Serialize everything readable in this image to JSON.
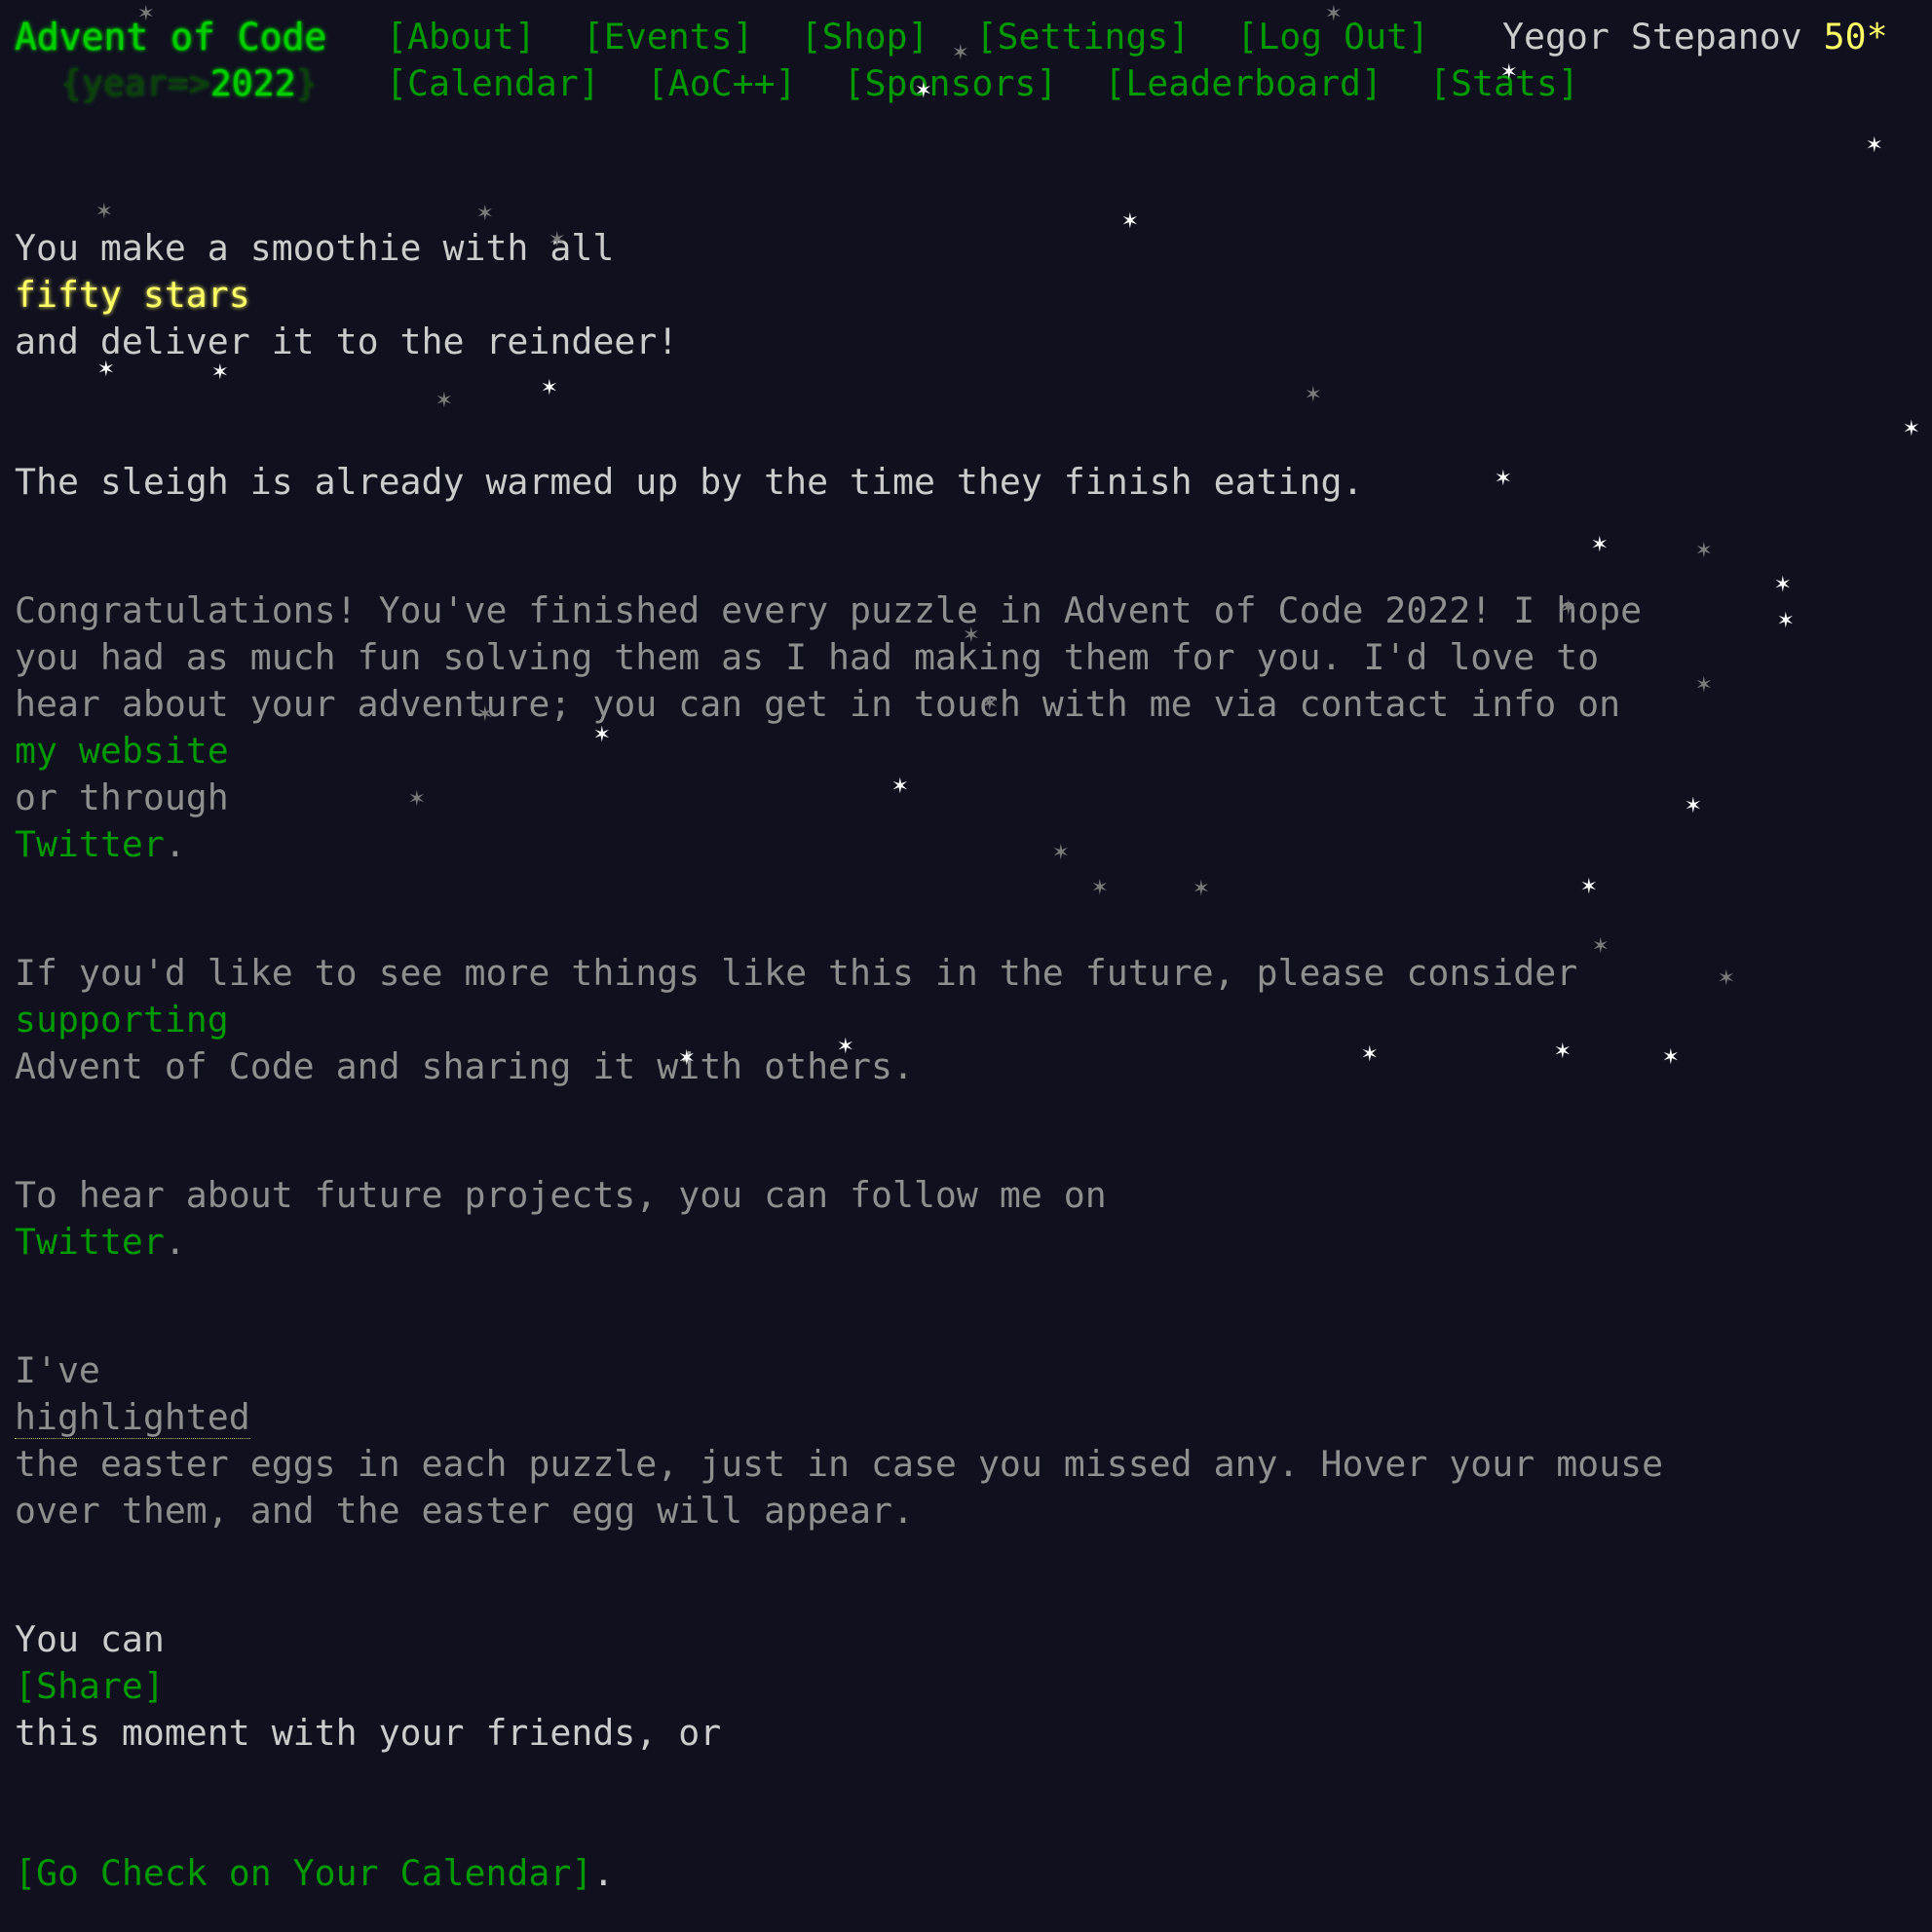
{
  "header": {
    "title": "Advent of Code",
    "year_prefix": "{year=>",
    "year": "2022",
    "year_suffix": "}",
    "nav_primary": [
      {
        "label": "[About]"
      },
      {
        "label": "[Events]"
      },
      {
        "label": "[Shop]"
      },
      {
        "label": "[Settings]"
      },
      {
        "label": "[Log Out]"
      }
    ],
    "nav_secondary": [
      {
        "label": "[Calendar]"
      },
      {
        "label": "[AoC++]"
      },
      {
        "label": "[Sponsors]"
      },
      {
        "label": "[Leaderboard]"
      },
      {
        "label": "[Stats]"
      }
    ],
    "user_name": "Yegor Stepanov",
    "star_count": "50*"
  },
  "content": {
    "intro_1": "You make a smoothie with all",
    "intro_highlight": "fifty stars",
    "intro_2": "and deliver it to the reindeer!",
    "intro_3": "The sleigh is already warmed up by the time they finish eating.",
    "congrats_1": "Congratulations! You've finished every puzzle in Advent of Code 2022! I hope you had as much fun solving them as I had making them for you. I'd love to hear about your adventure; you can get in touch with me via contact info on",
    "my_website": "my website",
    "or_through": "or through",
    "twitter_1": "Twitter",
    "period_1": ".",
    "future_1": "If you'd like to see more things like this in the future, please consider",
    "supporting": "supporting",
    "future_2": "Advent of Code and sharing it with others.",
    "hear_1": "To hear about future projects, you can follow me on",
    "twitter_2": "Twitter",
    "period_2": ".",
    "eggs_1": "I've",
    "highlighted": "highlighted",
    "eggs_2": "the easter eggs in each puzzle, just in case you missed any. Hover your mouse over them, and the easter egg will appear.",
    "share_1": "You can",
    "share_link": "[Share]",
    "share_2": "this moment with your friends, or",
    "calendar_link": "[Go Check on Your Calendar]",
    "period_3": "."
  },
  "colors": {
    "background": "#10101f",
    "accent_green": "#009900",
    "bright_green": "#00cc00",
    "star_yellow": "#ffff66",
    "text": "#cccccc",
    "muted": "#8f8f8f"
  }
}
